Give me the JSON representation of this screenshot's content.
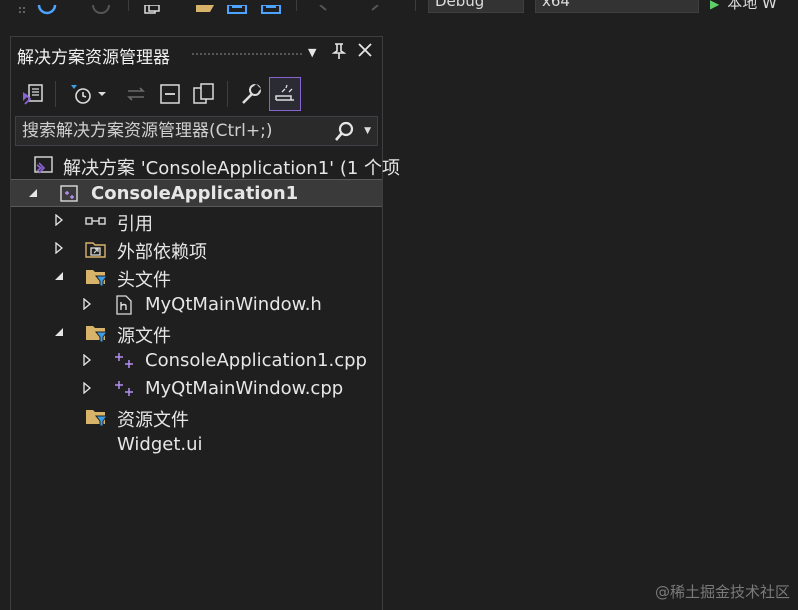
{
  "toolbar_top": {
    "config": "Debug",
    "platform": "x64",
    "run_label": "本地 W"
  },
  "panel": {
    "title": "解决方案资源管理器",
    "search_placeholder": "搜索解决方案资源管理器(Ctrl+;)"
  },
  "tree": {
    "solution": "解决方案 'ConsoleApplication1' (1 个项",
    "project": "ConsoleApplication1",
    "references": "引用",
    "external_deps": "外部依赖项",
    "header_files": "头文件",
    "header_1": "MyQtMainWindow.h",
    "source_files": "源文件",
    "source_1": "ConsoleApplication1.cpp",
    "source_2": "MyQtMainWindow.cpp",
    "resource_files": "资源文件",
    "widget_ui": "Widget.ui"
  },
  "watermark": "@稀土掘金技术社区",
  "colors": {
    "background": "#1f1f1f",
    "selected_row": "#3a3a3a",
    "accent_purple": "#8a63d2",
    "folder_yellow": "#d7b46a",
    "filter_blue": "#3c9ee6",
    "cpp_purple": "#b48ef0"
  }
}
